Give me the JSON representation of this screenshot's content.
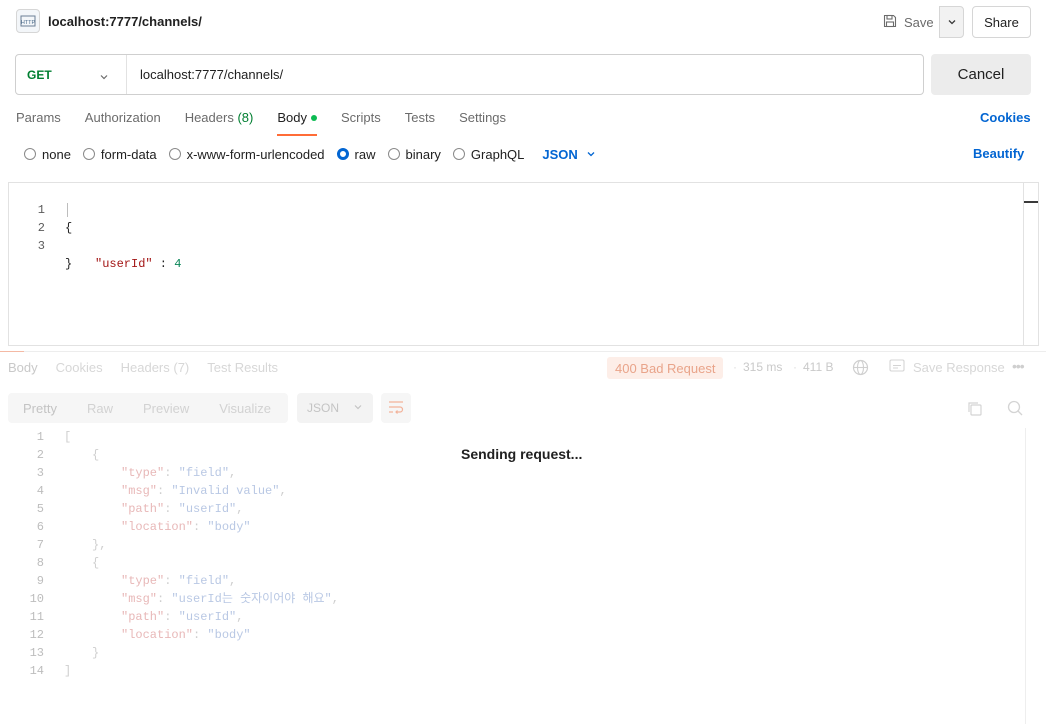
{
  "tab": {
    "title": "localhost:7777/channels/",
    "icon": "http-icon"
  },
  "header": {
    "save_label": "Save",
    "share_label": "Share"
  },
  "request": {
    "method": "GET",
    "url": "localhost:7777/channels/",
    "cancel_label": "Cancel"
  },
  "request_tabs": [
    {
      "label": "Params"
    },
    {
      "label": "Authorization"
    },
    {
      "label": "Headers",
      "count": "(8)"
    },
    {
      "label": "Body",
      "active": true
    },
    {
      "label": "Scripts"
    },
    {
      "label": "Tests"
    },
    {
      "label": "Settings"
    }
  ],
  "cookies_label": "Cookies",
  "body_types": {
    "options": [
      "none",
      "form-data",
      "x-www-form-urlencoded",
      "raw",
      "binary",
      "GraphQL"
    ],
    "selected": "raw",
    "format": "JSON",
    "beautify_label": "Beautify"
  },
  "request_body": {
    "line_numbers": [
      "1",
      "2",
      "3"
    ],
    "lines": [
      "{",
      "\"userId\"",
      " : ",
      "4",
      "}"
    ]
  },
  "response": {
    "tabs": [
      "Body",
      "Cookies",
      "Headers (7)",
      "Test Results"
    ],
    "status": "400 Bad Request",
    "time": "315 ms",
    "size": "411 B",
    "save_response_label": "Save Response",
    "views": [
      "Pretty",
      "Raw",
      "Preview",
      "Visualize"
    ],
    "format": "JSON",
    "sending_text": "Sending request...",
    "line_numbers": [
      "1",
      "2",
      "3",
      "4",
      "5",
      "6",
      "7",
      "8",
      "9",
      "10",
      "11",
      "12",
      "13",
      "14"
    ],
    "body": {
      "open_bracket": "[",
      "open_brace": "{",
      "close_brace_comma": "},",
      "close_brace": "}",
      "close_bracket": "]",
      "k_type": "\"type\"",
      "k_msg": "\"msg\"",
      "k_path": "\"path\"",
      "k_location": "\"location\"",
      "v_field": "\"field\"",
      "v_invalid": "\"Invalid value\"",
      "v_userid": "\"userId\"",
      "v_body": "\"body\"",
      "v_korean": "\"userId는 숫자이어야 해요\""
    }
  },
  "colors": {
    "accent": "#ff6c37",
    "link": "#0265d2",
    "method_get": "#007f31",
    "status_error": "#e9a48a"
  }
}
